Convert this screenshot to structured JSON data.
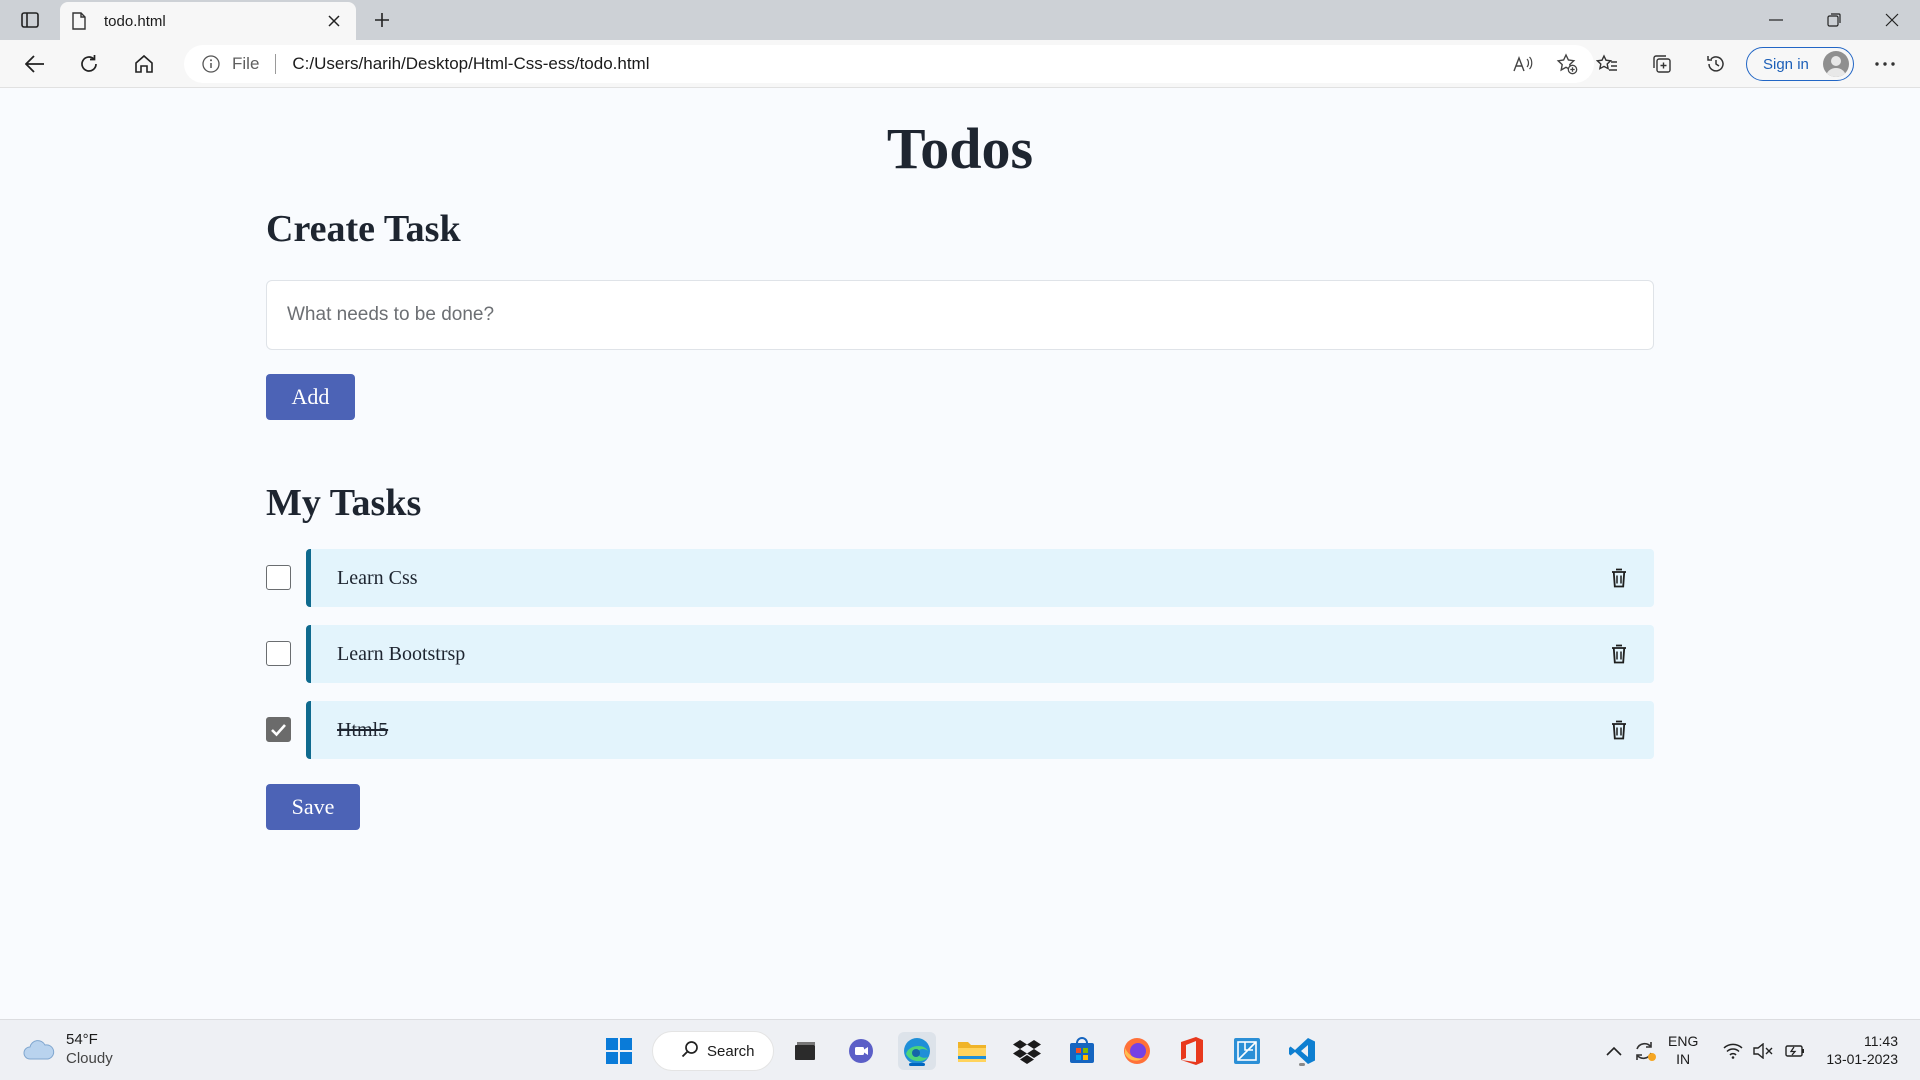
{
  "browser": {
    "tab_title": "todo.html",
    "address": {
      "scheme_label": "File",
      "url": "C:/Users/harih/Desktop/Html-Css-ess/todo.html"
    },
    "sign_in_label": "Sign in"
  },
  "page": {
    "title": "Todos",
    "create_section": {
      "bold": "Create",
      "rest": " Task"
    },
    "task_input": {
      "value": "",
      "placeholder": "What needs to be done?"
    },
    "add_button": "Add",
    "tasks_section": {
      "bold": "My",
      "rest": " Tasks"
    },
    "tasks": [
      {
        "label": "Learn Css",
        "checked": false
      },
      {
        "label": "Learn Bootstrsp",
        "checked": false
      },
      {
        "label": "Html5",
        "checked": true
      }
    ],
    "save_button": "Save"
  },
  "taskbar": {
    "weather": {
      "temp": "54°F",
      "condition": "Cloudy"
    },
    "search_label": "Search",
    "language": {
      "line1": "ENG",
      "line2": "IN"
    },
    "clock": {
      "time": "11:43",
      "date": "13-01-2023"
    }
  },
  "colors": {
    "accent_button": "#4c63b6",
    "task_card_bg": "#e3f4fc",
    "task_card_border": "#0f6a8e",
    "page_bg": "#f9fbfe"
  },
  "icons": [
    "tab-actions-icon",
    "page-icon",
    "close-icon",
    "plus-icon",
    "minimize-icon",
    "restore-icon",
    "back-icon",
    "refresh-icon",
    "home-icon",
    "info-icon",
    "read-aloud-icon",
    "add-favorite-icon",
    "favorites-icon",
    "collections-icon",
    "history-icon",
    "more-icon",
    "trash-icon",
    "checkmark-icon",
    "cloud-icon",
    "windows-start-icon",
    "search-icon",
    "task-view-icon",
    "chat-icon",
    "edge-icon",
    "file-explorer-icon",
    "dropbox-icon",
    "store-icon",
    "firefox-icon",
    "office-icon",
    "app-icon",
    "vscode-icon",
    "chevron-up-icon",
    "sync-icon",
    "wifi-icon",
    "mute-icon",
    "battery-icon"
  ]
}
